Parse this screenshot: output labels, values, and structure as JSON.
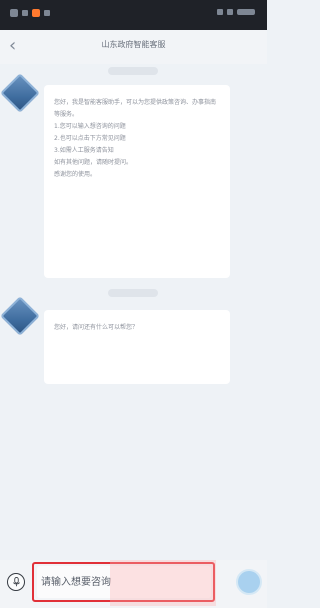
{
  "status_bar": {
    "dots": [
      "gray",
      "gray",
      "orange",
      "gray"
    ],
    "right_dots": [
      "gray",
      "gray",
      "gray"
    ]
  },
  "header": {
    "title": "山东政府智能客服"
  },
  "messages": [
    {
      "sender": "assistant",
      "text": "您好，我是智能客服助手，可以为您提供政策咨询、办事指南等服务。\n1.您可以输入想咨询的问题\n2.也可以点击下方常见问题\n3.如需人工服务请告知\n如有其他问题，请随时提问。\n感谢您的使用。"
    },
    {
      "sender": "assistant",
      "text": "您好，请问还有什么可以帮您？"
    }
  ],
  "input": {
    "placeholder": "请输入想要咨询"
  },
  "colors": {
    "accent_red": "#e13038",
    "avatar_blue": "#3f6d9f",
    "status_orange": "#ff7a2f"
  },
  "icons": {
    "back": "chevron-left-icon",
    "mic": "microphone-icon",
    "send": "send-icon"
  }
}
